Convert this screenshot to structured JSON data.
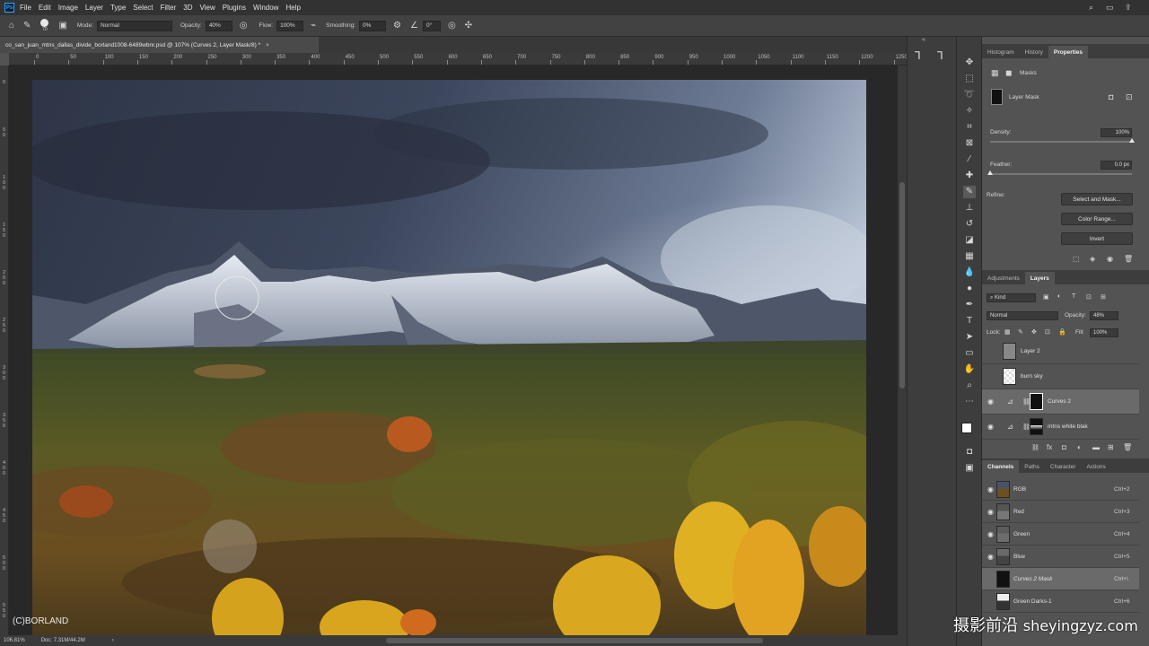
{
  "menu": {
    "items": [
      "File",
      "Edit",
      "Image",
      "Layer",
      "Type",
      "Select",
      "Filter",
      "3D",
      "View",
      "Plugins",
      "Window",
      "Help"
    ]
  },
  "options": {
    "brush_size": "70",
    "mode_label": "Mode:",
    "mode_value": "Normal",
    "opacity_label": "Opacity:",
    "opacity_value": "40%",
    "flow_label": "Flow:",
    "flow_value": "100%",
    "smoothing_label": "Smoothing:",
    "smoothing_value": "0%",
    "angle_value": "0°"
  },
  "document": {
    "tab_title": "co_san_juan_mtns_dallas_divide_borland1008-6489wbnr.psd @ 107% (Curves 2, Layer Mask/8) *",
    "ruler_top_ticks": [
      "0",
      "50",
      "100",
      "150",
      "200",
      "250",
      "300",
      "350",
      "400",
      "450",
      "500",
      "550",
      "600",
      "650",
      "700",
      "750",
      "800",
      "850",
      "900",
      "950",
      "1000",
      "1050",
      "1100",
      "1150",
      "1200",
      "1250",
      "1300"
    ],
    "ruler_left_ticks": [
      "0",
      "50",
      "100",
      "150",
      "200",
      "250",
      "300",
      "350",
      "400",
      "450",
      "500",
      "550",
      "600"
    ],
    "watermark": "(C)BORLAND"
  },
  "status": {
    "zoom": "106.81%",
    "doc_info": "Doc: 7.31M/44.2M"
  },
  "properties_panel": {
    "tabs": [
      "Histogram",
      "History",
      "Properties"
    ],
    "active_tab": "Properties",
    "section": "Masks",
    "mask_label": "Layer Mask",
    "density_label": "Density:",
    "density_value": "100%",
    "density_fraction": 1.0,
    "feather_label": "Feather:",
    "feather_value": "0.0 px",
    "feather_fraction": 0.0,
    "refine_label": "Refine:",
    "select_mask_btn": "Select and Mask...",
    "color_range_btn": "Color Range...",
    "invert_btn": "Invert"
  },
  "layers_panel": {
    "tabs": [
      "Adjustments",
      "Layers"
    ],
    "active_tab": "Layers",
    "kind_filter": "Kind",
    "blend_mode": "Normal",
    "opacity_label": "Opacity:",
    "opacity_value": "48%",
    "lock_label": "Lock:",
    "fill_label": "Fill:",
    "fill_value": "100%",
    "layers": [
      {
        "name": "Layer 2",
        "visible": false,
        "selected": false
      },
      {
        "name": "burn sky",
        "visible": false,
        "selected": false
      },
      {
        "name": "Curves 2",
        "visible": true,
        "selected": true
      },
      {
        "name": "mtns white blak",
        "visible": true,
        "selected": false
      }
    ]
  },
  "channels_panel": {
    "tabs": [
      "Channels",
      "Paths",
      "Character",
      "Actions"
    ],
    "active_tab": "Channels",
    "channels": [
      {
        "name": "RGB",
        "shortcut": "Ctrl+2",
        "visible": true
      },
      {
        "name": "Red",
        "shortcut": "Ctrl+3",
        "visible": true
      },
      {
        "name": "Green",
        "shortcut": "Ctrl+4",
        "visible": true
      },
      {
        "name": "Blue",
        "shortcut": "Ctrl+5",
        "visible": true
      },
      {
        "name": "Curves 2 Mask",
        "shortcut": "Ctrl+\\",
        "visible": false
      },
      {
        "name": "Green Darks-1",
        "shortcut": "Ctrl+6",
        "visible": false
      }
    ]
  },
  "site_watermark": {
    "cjk": "摄影前沿",
    "latin": "sheyingzyz.com"
  }
}
